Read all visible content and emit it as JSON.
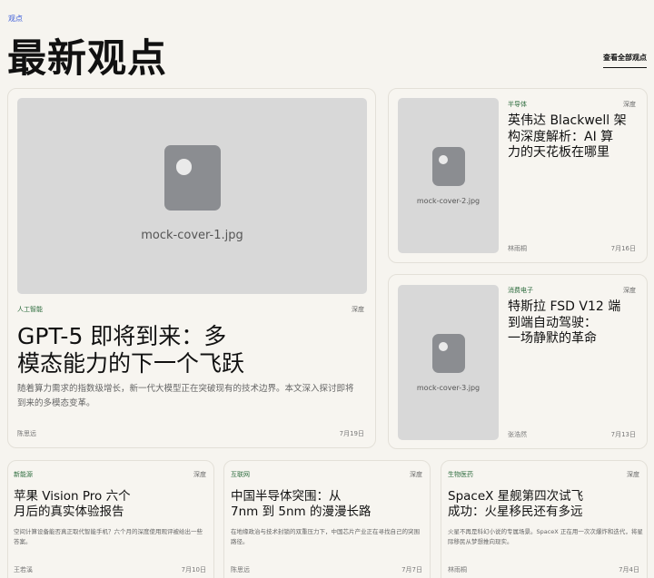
{
  "breadcrumb": "观点",
  "page_title": "最新观点",
  "view_all": "查看全部观点",
  "featured": {
    "cover": "mock-cover-1.jpg",
    "category": "人工智能",
    "tag": "深度",
    "title_line1": "GPT-5 即将到来：多",
    "title_line2": "模态能力的下一个飞跃",
    "summary_line1": "随着算力需求的指数级增长，新一代大模型正在突破现有的技术边界。本文深入探讨即将",
    "summary_line2": "到来的多模态变革。",
    "author": "陈思远",
    "date": "7月19日"
  },
  "side_articles": [
    {
      "cover": "mock-cover-2.jpg",
      "category": "半导体",
      "tag": "深度",
      "title_lines": [
        "英伟达 Blackwell 架",
        "构深度解析：AI 算",
        "力的天花板在哪里"
      ],
      "author": "林雨桐",
      "date": "7月16日"
    },
    {
      "cover": "mock-cover-3.jpg",
      "category": "消费电子",
      "tag": "深度",
      "title_lines": [
        "特斯拉 FSD V12 端",
        "到端自动驾驶：",
        "一场静默的革命"
      ],
      "author": "张浩然",
      "date": "7月13日"
    }
  ],
  "bottom_articles": [
    {
      "category": "新能源",
      "tag": "深度",
      "title_lines": [
        "苹果 Vision Pro 六个",
        "月后的真实体验报告"
      ],
      "summary_lines": [
        "空间计算设备能否真正取代智能手机？六个月的深度使用观评被给出一些",
        "答案。"
      ],
      "author": "王若溪",
      "date": "7月10日"
    },
    {
      "category": "互联网",
      "tag": "深度",
      "title_lines": [
        "中国半导体突围：从",
        "7nm 到 5nm 的漫漫长路"
      ],
      "summary_lines": [
        "在地缘政治与技术封锁的双重压力下，中国芯片产业正在寻找自己的突围",
        "路径。"
      ],
      "author": "陈思远",
      "date": "7月7日"
    },
    {
      "category": "生物医药",
      "tag": "深度",
      "title_lines": [
        "SpaceX 星舰第四次试飞",
        "成功：火星移民还有多远"
      ],
      "summary_lines": [
        "火星不再是科幻小说的专属场景。SpaceX 正在用一次次爆炸和迭代，将星",
        "际移民从梦想推向现实。"
      ],
      "author": "林雨桐",
      "date": "7月4日"
    }
  ]
}
